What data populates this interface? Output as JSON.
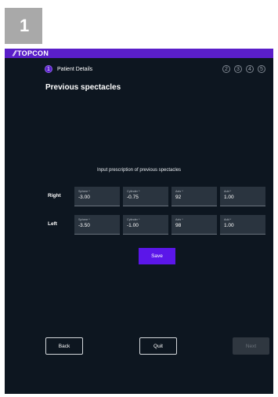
{
  "figure_label": "1",
  "brand": {
    "logo_text": "TOPCON"
  },
  "progress": {
    "current_step_number": "1",
    "current_step_label": "Patient Details",
    "remaining_steps": [
      "2",
      "3",
      "4",
      "5"
    ]
  },
  "page": {
    "title": "Previous spectacles",
    "instruction": "Input prescription of previous spectacles"
  },
  "prescription": {
    "right": {
      "label": "Right",
      "fields": [
        {
          "label": "Sphere *",
          "value": "-3.00"
        },
        {
          "label": "Cylinder *",
          "value": "-0.75"
        },
        {
          "label": "Axis *",
          "value": "92"
        },
        {
          "label": "Add *",
          "value": "1.00"
        }
      ]
    },
    "left": {
      "label": "Left",
      "fields": [
        {
          "label": "Sphere *",
          "value": "-3.50"
        },
        {
          "label": "Cylinder *",
          "value": "-1.00"
        },
        {
          "label": "Axis *",
          "value": "98"
        },
        {
          "label": "Add *",
          "value": "1.00"
        }
      ]
    }
  },
  "buttons": {
    "save": "Save",
    "back": "Back",
    "quit": "Quit",
    "next": "Next"
  },
  "colors": {
    "accent": "#5a1ec9",
    "background": "#0d1620",
    "field": "#2a343f"
  }
}
